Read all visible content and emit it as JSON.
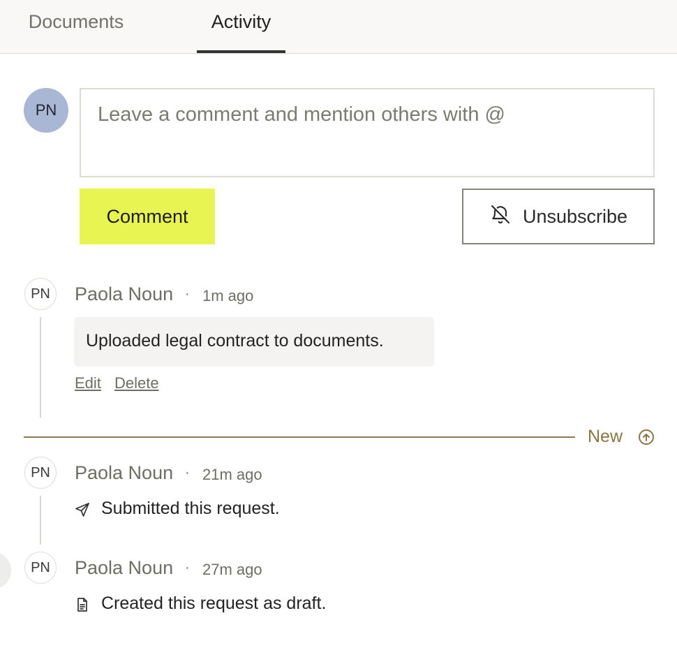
{
  "tabs": [
    {
      "label": "Documents",
      "active": false
    },
    {
      "label": "Activity",
      "active": true
    }
  ],
  "composer": {
    "avatar_initials": "PN",
    "placeholder": "Leave a comment and mention others with @",
    "comment_button": "Comment",
    "unsubscribe_button": "Unsubscribe",
    "unsubscribe_icon": "bell-off-icon"
  },
  "activity": [
    {
      "initials": "PN",
      "author": "Paola Noun",
      "time": "1m ago",
      "message": "Uploaded legal contract to documents.",
      "actions": [
        "Edit",
        "Delete"
      ]
    },
    {
      "initials": "PN",
      "author": "Paola Noun",
      "time": "21m ago",
      "icon": "send-icon",
      "text": "Submitted this request."
    },
    {
      "initials": "PN",
      "author": "Paola Noun",
      "time": "27m ago",
      "icon": "document-icon",
      "text": "Created this request as draft."
    }
  ],
  "new_divider": {
    "label": "New",
    "icon": "arrow-up-circle-icon"
  },
  "colors": {
    "accent": "#e8f451",
    "avatar": "#a9b7d5",
    "divider": "#8a7a4f"
  }
}
